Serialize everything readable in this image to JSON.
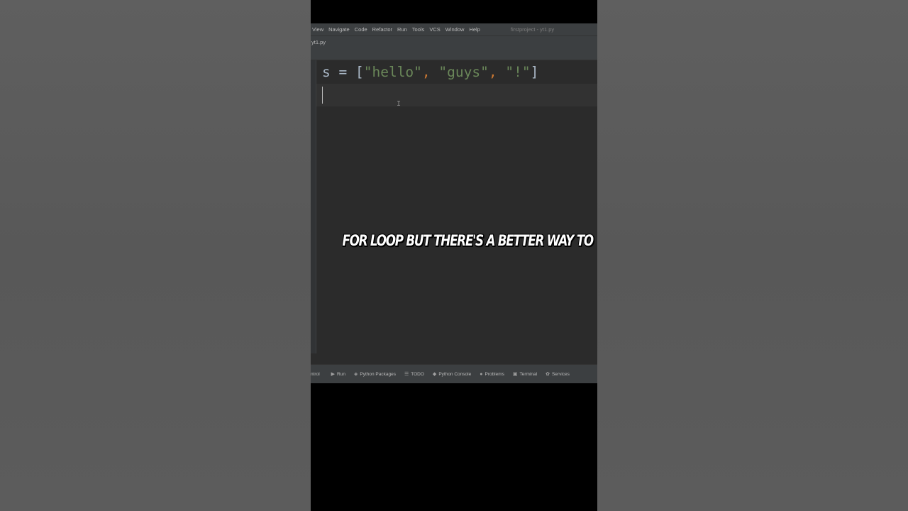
{
  "menu": {
    "items": [
      "View",
      "Navigate",
      "Code",
      "Refactor",
      "Run",
      "Tools",
      "VCS",
      "Window",
      "Help"
    ],
    "project_title": "firstproject - yt1.py"
  },
  "tab": {
    "filename": "yt1.py"
  },
  "editor": {
    "line1": {
      "var": "s",
      "op": " = ",
      "open": "[",
      "s1": "\"hello\"",
      "c1": ", ",
      "s2": "\"guys\"",
      "c2": ", ",
      "s3": "\"!\"",
      "close": "]"
    }
  },
  "caption": "FOR LOOP BUT THERE'S A BETTER WAY TO",
  "bottom_tools": [
    {
      "label": "ntrol",
      "icon": ""
    },
    {
      "label": "Run",
      "icon": "play-icon"
    },
    {
      "label": "Python Packages",
      "icon": "packages-icon"
    },
    {
      "label": "TODO",
      "icon": "list-icon"
    },
    {
      "label": "Python Console",
      "icon": "python-icon"
    },
    {
      "label": "Problems",
      "icon": "info-icon"
    },
    {
      "label": "Terminal",
      "icon": "terminal-icon"
    },
    {
      "label": "Services",
      "icon": "services-icon"
    }
  ],
  "colors": {
    "ide_bg": "#2b2b2b",
    "string": "#6a8759",
    "punctuation": "#cc7832",
    "code_text": "#a9b7c6"
  }
}
